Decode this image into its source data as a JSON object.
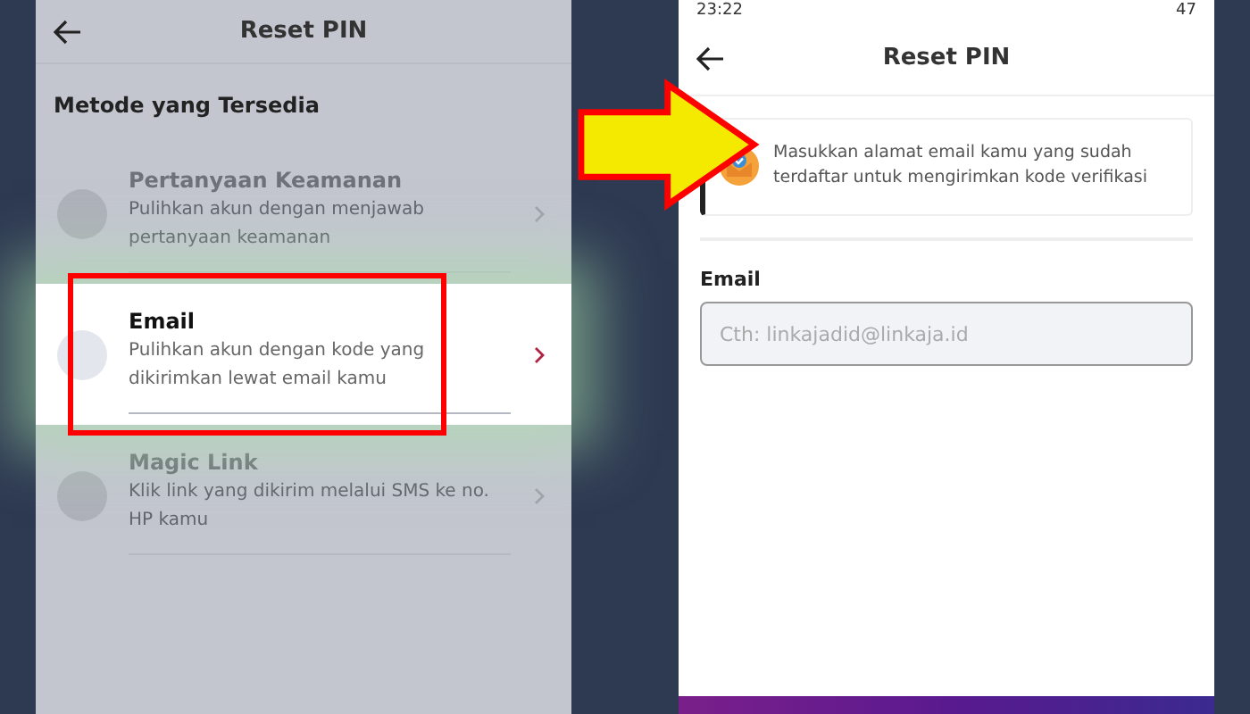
{
  "left_screen": {
    "title": "Reset PIN",
    "section_title": "Metode yang Tersedia",
    "methods": [
      {
        "title": "Pertanyaan Keamanan",
        "description": "Pulihkan akun dengan menjawab pertanyaan keamanan",
        "highlighted": false
      },
      {
        "title": "Email",
        "description": "Pulihkan akun dengan kode yang dikirimkan lewat email kamu",
        "highlighted": true
      },
      {
        "title": "Magic Link",
        "description": "Klik link yang dikirim melalui SMS ke no. HP kamu",
        "highlighted": false
      }
    ]
  },
  "right_screen": {
    "status_bar": {
      "time": "23:22",
      "battery": "47"
    },
    "title": "Reset PIN",
    "info_text": "Masukkan alamat email kamu yang sudah terdaftar untuk mengirimkan kode verifikasi",
    "email_label": "Email",
    "email_placeholder": "Cth: linkajadid@linkaja.id"
  }
}
